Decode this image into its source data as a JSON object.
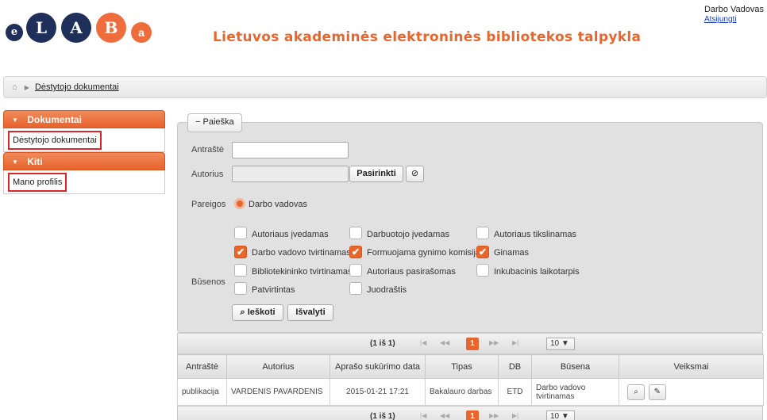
{
  "header": {
    "logo_letters": [
      "e",
      "L",
      "A",
      "B",
      "a"
    ],
    "site_title": "Lietuvos akademinės elektroninės bibliotekos talpykla",
    "user_name": "Darbo Vadovas",
    "logout_label": "Atsijungti"
  },
  "breadcrumb": {
    "home_icon": "home-icon",
    "current": "Dėstytojo dokumentai"
  },
  "sidebar": {
    "sections": [
      {
        "title": "Dokumentai",
        "item": "Dėstytojo dokumentai"
      },
      {
        "title": "Kiti",
        "item": "Mano profilis"
      }
    ]
  },
  "search": {
    "toggle_label": "Paieška",
    "title_label": "Antraštė",
    "title_value": "",
    "author_label": "Autorius",
    "author_value": "",
    "choose_button": "Pasirinkti",
    "role_label": "Pareigos",
    "role_option": "Darbo vadovas",
    "status_label": "Būsenos",
    "statuses": [
      {
        "label": "Autoriaus įvedamas",
        "checked": false
      },
      {
        "label": "Darbuotojo įvedamas",
        "checked": false
      },
      {
        "label": "Autoriaus tikslinamas",
        "checked": false
      },
      {
        "label": "Darbo vadovo tvirtinamas",
        "checked": true
      },
      {
        "label": "Formuojama gynimo komisija",
        "checked": true
      },
      {
        "label": "Ginamas",
        "checked": true
      },
      {
        "label": "Bibliotekininko tvirtinamas",
        "checked": false
      },
      {
        "label": "Autoriaus pasirašomas",
        "checked": false
      },
      {
        "label": "Inkubacinis laikotarpis",
        "checked": false
      },
      {
        "label": "Patvirtintas",
        "checked": false
      },
      {
        "label": "Juodraštis",
        "checked": false
      }
    ],
    "search_button": "Ieškoti",
    "clear_button": "Išvalyti"
  },
  "results": {
    "pager_info": "(1 iš 1)",
    "current_page": "1",
    "page_size": "10",
    "columns": [
      "Antraštė",
      "Autorius",
      "Aprašo sukūrimo data",
      "Tipas",
      "DB",
      "Būsena",
      "Veiksmai"
    ],
    "rows": [
      {
        "title": "publikacija",
        "author": "VARDENIS PAVARDENIS",
        "created": "2015-01-21 17:21",
        "type": "Bakalauro darbas",
        "db": "ETD",
        "status": "Darbo vadovo tvirtinamas"
      }
    ]
  }
}
